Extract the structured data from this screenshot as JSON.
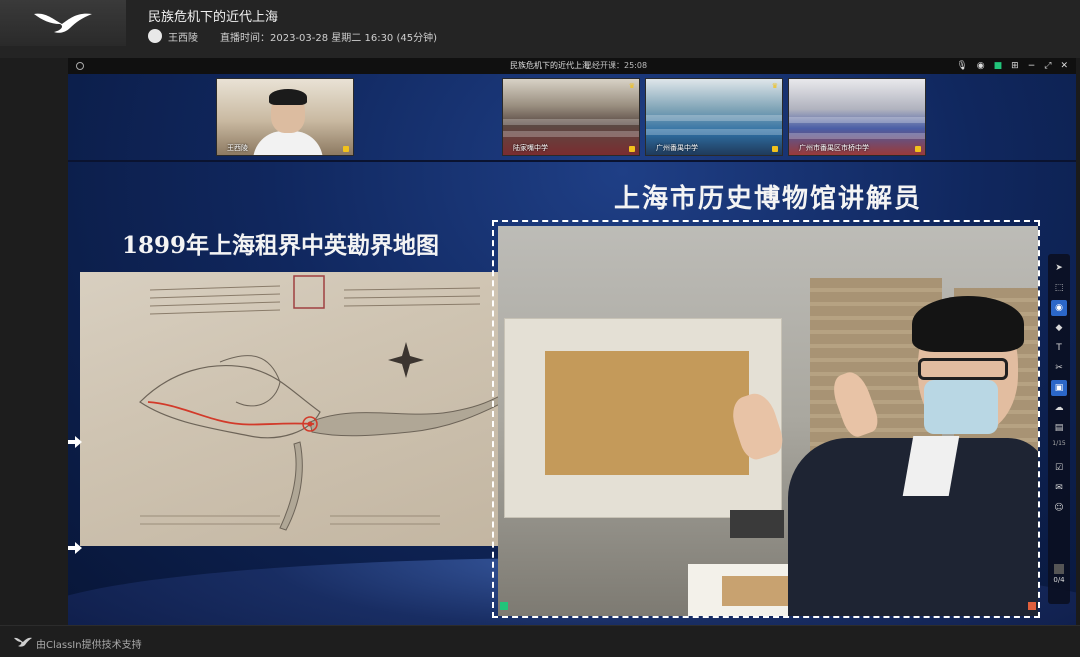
{
  "header": {
    "course_title": "民族危机下的近代上海",
    "teacher_name": "王西陵",
    "schedule": "直播时间：2023-03-28 星期二 16:30 (45分钟)"
  },
  "classroom": {
    "room_title": "民族危机下的近代上海",
    "elapsed": "已经开课：25:08",
    "videos": [
      {
        "label": "王西陵",
        "role": "teacher"
      },
      {
        "label": "陆家嘴中学",
        "role": "class"
      },
      {
        "label": "广州番禺中学",
        "role": "class"
      },
      {
        "label": "广州市番禺区市桥中学",
        "role": "class"
      }
    ]
  },
  "slide": {
    "title_right": "上海市历史博物馆讲解员",
    "title_left": "1899年上海租界中英勘界地图"
  },
  "toolbar": {
    "tools": [
      "cursor-icon",
      "select-icon",
      "fill-icon",
      "eraser-icon",
      "text-icon",
      "scissors-icon",
      "camera-icon",
      "cloud-icon",
      "box-icon"
    ],
    "zoom": "1/15",
    "page": "0/4"
  },
  "footer": {
    "powered_by": "由ClassIn提供技术支持"
  },
  "colors": {
    "accent": "#2b67c8",
    "live_green": "#21c47a",
    "mic_yellow": "#f2c21c"
  }
}
